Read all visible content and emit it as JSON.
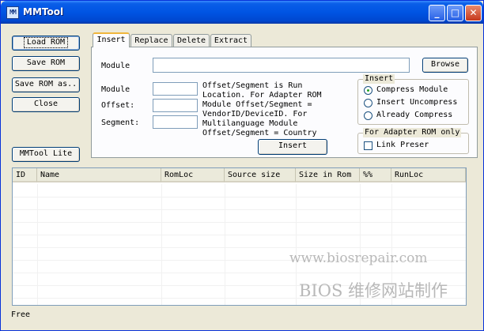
{
  "window": {
    "title": "MMTool",
    "app_icon_text": "MM",
    "minimize_label": "_",
    "maximize_label": "□",
    "close_label": "✕"
  },
  "left_buttons": {
    "load_rom": "Load ROM",
    "save_rom": "Save ROM",
    "save_rom_as": "Save ROM as..",
    "close": "Close",
    "mmtool_lite": "MMTool Lite"
  },
  "tabs": [
    "Insert",
    "Replace",
    "Delete",
    "Extract"
  ],
  "insert_tab": {
    "module_label": "Module",
    "module_file_value": "",
    "browse_button": "Browse",
    "module_id_label": "Module",
    "module_id_value": "",
    "offset_label": "Offset:",
    "offset_value": "",
    "segment_label": "Segment:",
    "segment_value": "",
    "help_text": [
      "Offset/Segment is Run",
      "Location. For Adapter ROM",
      "Module Offset/Segment =",
      "VendorID/DeviceID. For",
      "Multilanguage Module",
      "Offset/Segment = Country"
    ],
    "insert_button": "Insert",
    "insert_group": {
      "legend": "Insert",
      "options": [
        "Compress Module",
        "Insert Uncompress",
        "Already Compress"
      ],
      "selected_index": 0
    },
    "adapter_group": {
      "legend": "For Adapter ROM only",
      "checkbox_label": "Link Preser",
      "checked": false
    }
  },
  "list": {
    "columns": [
      "ID",
      "Name",
      "RomLoc",
      "Source size",
      "Size in Rom",
      "%%",
      "RunLoc"
    ],
    "rows": []
  },
  "watermark": {
    "line1": "www.biosrepair.com",
    "line2": "BIOS 维修网站制作"
  },
  "status": {
    "free_label": "Free"
  }
}
